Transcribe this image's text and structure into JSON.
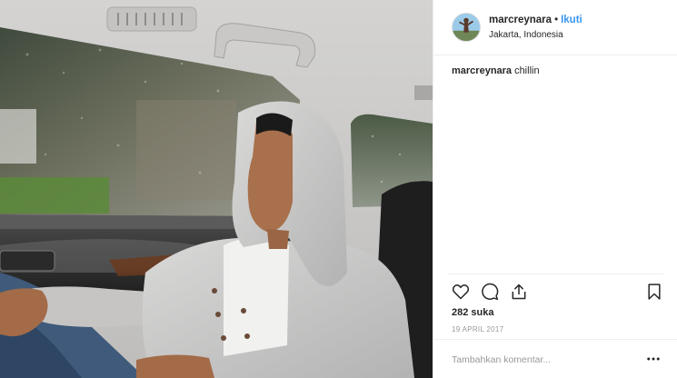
{
  "post": {
    "username": "marcreynara",
    "separator": "•",
    "follow_label": "Ikuti",
    "location": "Jakarta, Indonesia",
    "caption_user": "marcreynara",
    "caption_text": "chillin",
    "likes": "282 suka",
    "date": "19 APRIL 2017",
    "comment_placeholder": "Tambahkan komentar...",
    "icons": {
      "like": "heart-icon",
      "comment": "comment-bubble-icon",
      "share": "share-icon",
      "save": "bookmark-icon",
      "more": "more-options-icon"
    }
  },
  "colors": {
    "link_blue": "#3897f0",
    "text": "#262626",
    "muted": "#999999",
    "divider": "#efefef"
  }
}
